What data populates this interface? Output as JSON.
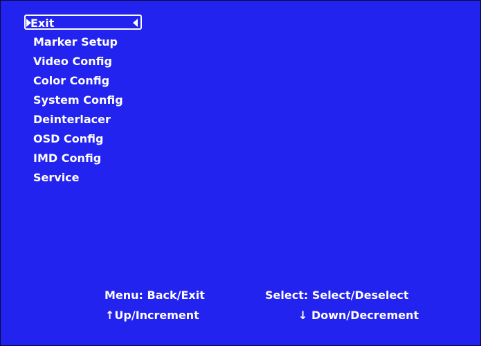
{
  "menu": {
    "items": [
      {
        "label": "Exit"
      },
      {
        "label": "Marker Setup"
      },
      {
        "label": "Video Config"
      },
      {
        "label": "Color Config"
      },
      {
        "label": "System Config"
      },
      {
        "label": "Deinterlacer"
      },
      {
        "label": "OSD Config"
      },
      {
        "label": "IMD Config"
      },
      {
        "label": "Service"
      }
    ]
  },
  "footer": {
    "menu_hint": "Menu: Back/Exit",
    "select_hint": "Select: Select/Deselect",
    "up_hint": "↑Up/Increment",
    "down_hint": "↓ Down/Decrement"
  },
  "colors": {
    "background": "#2323f0",
    "text": "#ffffff"
  },
  "icons": {
    "selection_left": "triangle-right-icon",
    "selection_right": "triangle-left-icon"
  }
}
